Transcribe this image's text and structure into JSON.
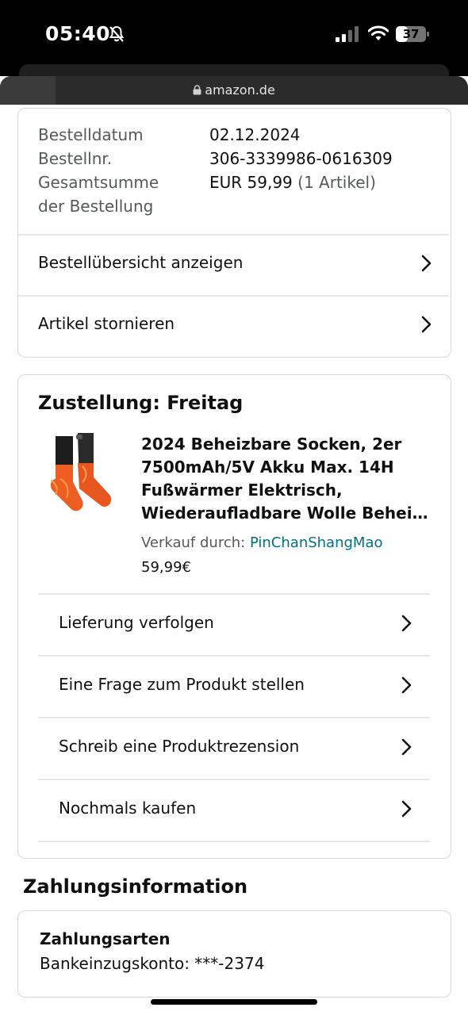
{
  "status_bar": {
    "time": "05:40",
    "battery": "37"
  },
  "browser": {
    "url": "amazon.de"
  },
  "order_info": {
    "rows": [
      {
        "label": "Bestelldatum",
        "value": "02.12.2024"
      },
      {
        "label": "Bestellnr.",
        "value": "306-3339986-0616309"
      }
    ],
    "total_label_line1": "Gesamtsumme",
    "total_label_line2": "der Bestellung",
    "total_value": "EUR 59,99",
    "total_count": "(1 Artikel)",
    "actions": [
      "Bestellübersicht anzeigen",
      "Artikel stornieren"
    ]
  },
  "delivery": {
    "heading": "Zustellung: Freitag",
    "product": {
      "title_lines": [
        "2024 Beheizbare Socken, 2er",
        "7500mAh/5V Akku Max. 14H",
        "Fußwärmer Elektrisch,",
        "Wiederaufladbare Wolle Beheiz…"
      ],
      "seller_label": "Verkauf durch:",
      "seller_name": "PinChanShangMao",
      "price": "59,99€"
    },
    "actions": [
      "Lieferung verfolgen",
      "Eine Frage zum Produkt stellen",
      "Schreib eine Produktrezension",
      "Nochmals kaufen"
    ]
  },
  "payment": {
    "heading": "Zahlungsinformation",
    "method_heading": "Zahlungsarten",
    "method_value": "Bankeinzugskonto: ***-2374"
  },
  "colors": {
    "link": "#007185",
    "text": "#0f1111",
    "muted": "#565959",
    "border": "#d5d9d9"
  }
}
